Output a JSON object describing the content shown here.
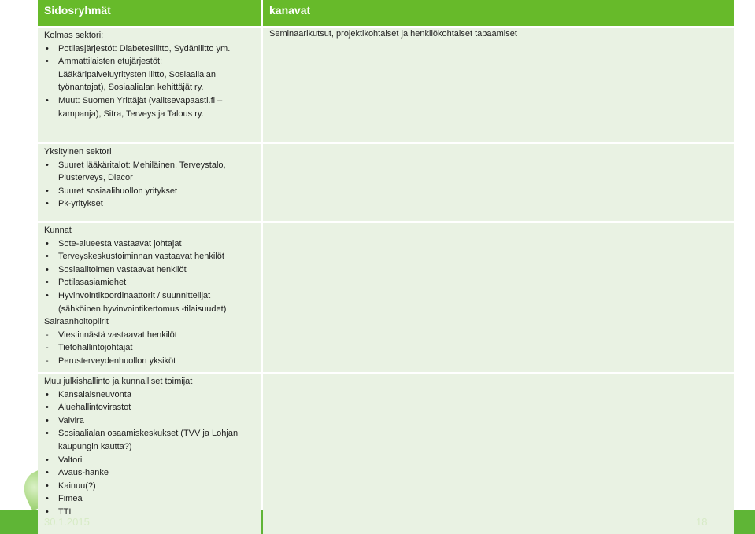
{
  "header": {
    "col1": "Sidosryhmät",
    "col2": "kanavat"
  },
  "rows": [
    {
      "heading": "Kolmas sektori:",
      "items": [
        {
          "marker": "•",
          "lines": [
            "Potilasjärjestöt: Diabetesliitto, Sydänliitto ym."
          ]
        },
        {
          "marker": "•",
          "lines": [
            "Ammattilaisten etujärjestöt:",
            "Lääkäripalveluyritysten liitto, Sosiaalialan",
            "työnantajat), Sosiaalialan kehittäjät ry."
          ]
        },
        {
          "marker": "•",
          "lines": [
            "Muut: Suomen Yrittäjät (valitsevapaasti.fi –",
            "kampanja), Sitra, Terveys ja Talous ry."
          ]
        }
      ],
      "channels": "Seminaarikutsut, projektikohtaiset ja  henkilökohtaiset tapaamiset"
    },
    {
      "heading": "Yksityinen sektori",
      "items": [
        {
          "marker": "•",
          "lines": [
            "Suuret lääkäritalot: Mehiläinen, Terveystalo,",
            "Plusterveys, Diacor"
          ]
        },
        {
          "marker": "•",
          "lines": [
            "Suuret sosiaalihuollon yritykset"
          ]
        },
        {
          "marker": "•",
          "lines": [
            "Pk-yritykset"
          ]
        }
      ]
    },
    {
      "heading": "Kunnat",
      "items": [
        {
          "marker": "•",
          "lines": [
            "Sote-alueesta vastaavat johtajat"
          ]
        },
        {
          "marker": "•",
          "lines": [
            "Terveyskeskustoiminnan vastaavat henkilöt"
          ]
        },
        {
          "marker": "•",
          "lines": [
            "Sosiaalitoimen vastaavat henkilöt"
          ]
        },
        {
          "marker": "•",
          "lines": [
            "Potilasasiamiehet"
          ]
        },
        {
          "marker": "•",
          "lines": [
            "Hyvinvointikoordinaattorit / suunnittelijat",
            "(sähköinen hyvinvointikertomus -tilaisuudet)"
          ]
        }
      ],
      "heading2": "Sairaanhoitopiirit",
      "items2": [
        {
          "marker": "-",
          "lines": [
            "Viestinnästä vastaavat henkilöt"
          ]
        },
        {
          "marker": "-",
          "lines": [
            "Tietohallintojohtajat"
          ]
        },
        {
          "marker": "-",
          "lines": [
            "Perusterveydenhuollon yksiköt"
          ]
        }
      ]
    },
    {
      "heading": "Muu julkishallinto ja kunnalliset toimijat",
      "items": [
        {
          "marker": "•",
          "lines": [
            "Kansalaisneuvonta"
          ]
        },
        {
          "marker": "•",
          "lines": [
            "Aluehallintovirastot"
          ]
        },
        {
          "marker": "•",
          "lines": [
            "Valvira"
          ]
        },
        {
          "marker": "•",
          "lines": [
            "Sosiaalialan osaamiskeskukset (TVV ja Lohjan",
            "kaupungin kautta?)"
          ]
        },
        {
          "marker": "•",
          "lines": [
            "Valtori"
          ]
        },
        {
          "marker": "•",
          "lines": [
            "Avaus-hanke"
          ]
        },
        {
          "marker": "•",
          "lines": [
            "Kainuu(?)"
          ]
        },
        {
          "marker": "•",
          "lines": [
            "Fimea"
          ]
        },
        {
          "marker": "•",
          "lines": [
            "TTL"
          ]
        }
      ]
    }
  ],
  "footer": {
    "date": "30.1.2015",
    "page": "18"
  },
  "colors": {
    "header_green": "#67ba2a",
    "cell_bg": "#e9f2e3",
    "footer_green": "#5fb536"
  }
}
